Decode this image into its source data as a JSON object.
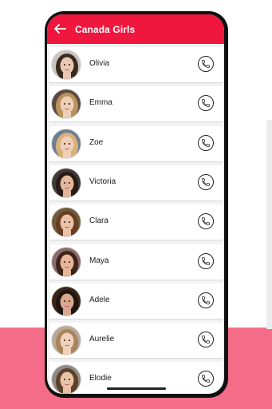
{
  "header": {
    "title": "Canada Girls"
  },
  "contacts": [
    {
      "name": "Olivia",
      "hair": "#3a2a1e",
      "skin": "#e9c8b4",
      "bg": "#c9c4bf"
    },
    {
      "name": "Emma",
      "hair": "#b9915a",
      "skin": "#efcfb7",
      "bg": "#5b4a43"
    },
    {
      "name": "Zoe",
      "hair": "#d8b27a",
      "skin": "#f0cfb8",
      "bg": "#6f7d90"
    },
    {
      "name": "Victoria",
      "hair": "#2a1a15",
      "skin": "#e2b89c",
      "bg": "#3f3a38"
    },
    {
      "name": "Clara",
      "hair": "#6a3d22",
      "skin": "#eac3a6",
      "bg": "#6e5d3a"
    },
    {
      "name": "Maya",
      "hair": "#3b2419",
      "skin": "#e6b59a",
      "bg": "#8a6b69"
    },
    {
      "name": "Adele",
      "hair": "#1e1410",
      "skin": "#d9a88e",
      "bg": "#3b2418"
    },
    {
      "name": "Aurelie",
      "hair": "#a7845a",
      "skin": "#f0d2bd",
      "bg": "#b9a89a"
    },
    {
      "name": "Elodie",
      "hair": "#5c4128",
      "skin": "#e8c3a6",
      "bg": "#8f8a85"
    }
  ],
  "icons": {
    "back": "arrow-left-icon",
    "call": "phone-icon"
  },
  "colors": {
    "accent": "#f0173f",
    "band": "#f56c88"
  }
}
